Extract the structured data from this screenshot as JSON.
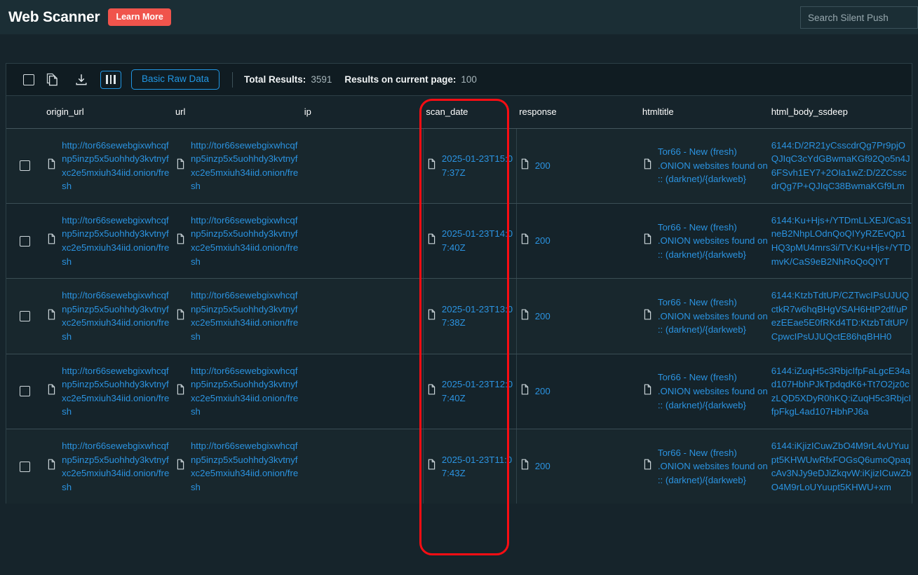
{
  "header": {
    "app_title": "Web Scanner",
    "learn_more_label": "Learn More",
    "search_placeholder": "Search Silent Push",
    "search_value": ""
  },
  "toolbar": {
    "select_all_icon": "checkbox-icon",
    "copy_icon": "copy-icon",
    "download_icon": "download-icon",
    "columns_icon": "columns-icon",
    "raw_data_label": "Basic Raw Data",
    "total_results_label": "Total Results:",
    "total_results_value": "3591",
    "page_results_label": "Results on current page:",
    "page_results_value": "100"
  },
  "table": {
    "columns": [
      "origin_url",
      "url",
      "ip",
      "scan_date",
      "response",
      "htmltitle",
      "html_body_ssdeep"
    ],
    "rows": [
      {
        "origin_url": "http://tor66sewebgixwhcqfnp5inzp5x5uohhdy3kvtnyfxc2e5mxiuh34iid.onion/fresh",
        "url": "http://tor66sewebgixwhcqfnp5inzp5x5uohhdy3kvtnyfxc2e5mxiuh34iid.onion/fresh",
        "ip": "",
        "scan_date": "2025-01-23T15:07:37Z",
        "response": "200",
        "htmltitle": "Tor66 - New (fresh) .ONION websites found on :: (darknet)/{darkweb}",
        "html_body_ssdeep": "6144:D/2R21yCsscdrQg7Pr9pjOQJIqC3cYdGBwmaKGf92Qo5n4J6FSvh1EY7+2OIa1wZ:D/2ZCsscdrQg7P+QJIqC38BwmaKGf9Lm"
      },
      {
        "origin_url": "http://tor66sewebgixwhcqfnp5inzp5x5uohhdy3kvtnyfxc2e5mxiuh34iid.onion/fresh",
        "url": "http://tor66sewebgixwhcqfnp5inzp5x5uohhdy3kvtnyfxc2e5mxiuh34iid.onion/fresh",
        "ip": "",
        "scan_date": "2025-01-23T14:07:40Z",
        "response": "200",
        "htmltitle": "Tor66 - New (fresh) .ONION websites found on :: (darknet)/{darkweb}",
        "html_body_ssdeep": "6144:Ku+Hjs+/YTDmLLXEJ/CaS1neB2NhpLOdnQoQIYyRZEvQp1HQ3pMU4mrs3i/TV:Ku+Hjs+/YTDmvK/CaS9eB2NhRoQoQIYT"
      },
      {
        "origin_url": "http://tor66sewebgixwhcqfnp5inzp5x5uohhdy3kvtnyfxc2e5mxiuh34iid.onion/fresh",
        "url": "http://tor66sewebgixwhcqfnp5inzp5x5uohhdy3kvtnyfxc2e5mxiuh34iid.onion/fresh",
        "ip": "",
        "scan_date": "2025-01-23T13:07:38Z",
        "response": "200",
        "htmltitle": "Tor66 - New (fresh) .ONION websites found on :: (darknet)/{darkweb}",
        "html_body_ssdeep": "6144:KtzbTdtUP/CZTwcIPsUJUQctkR7w6hqBHgVSAH6HtP2df/uPezEEae5E0fRKd4TD:KtzbTdtUP/CpwcIPsUJUQctE86hqBHH0"
      },
      {
        "origin_url": "http://tor66sewebgixwhcqfnp5inzp5x5uohhdy3kvtnyfxc2e5mxiuh34iid.onion/fresh",
        "url": "http://tor66sewebgixwhcqfnp5inzp5x5uohhdy3kvtnyfxc2e5mxiuh34iid.onion/fresh",
        "ip": "",
        "scan_date": "2025-01-23T12:07:40Z",
        "response": "200",
        "htmltitle": "Tor66 - New (fresh) .ONION websites found on :: (darknet)/{darkweb}",
        "html_body_ssdeep": "6144:iZuqH5c3RbjcIfpFaLgcE34ad107HbhPJkTpdqdK6+Tt7O2jz0czLQD5XDyR0hKQ:iZuqH5c3RbjcIfpFkgL4ad107HbhPJ6a"
      },
      {
        "origin_url": "http://tor66sewebgixwhcqfnp5inzp5x5uohhdy3kvtnyfxc2e5mxiuh34iid.onion/fresh",
        "url": "http://tor66sewebgixwhcqfnp5inzp5x5uohhdy3kvtnyfxc2e5mxiuh34iid.onion/fresh",
        "ip": "",
        "scan_date": "2025-01-23T11:07:43Z",
        "response": "200",
        "htmltitle": "Tor66 - New (fresh) .ONION websites found on :: (darknet)/{darkweb}",
        "html_body_ssdeep": "6144:iKjizICuwZbO4M9rL4vUYuupt5KHWUwRfxFOGsQ6umoQpaqcAv3NJy9eDJiZkqvW:iKjizICuwZbO4M9rLoUYuupt5KHWU+xm"
      }
    ]
  },
  "annotation": {
    "highlight_color": "#fb0d13",
    "highlighted_column": "scan_date"
  },
  "colors": {
    "page_bg": "#16242b",
    "topbar_bg": "#1b2e35",
    "accent_red": "#f0544c",
    "link_blue": "#2b93e0",
    "border_blue": "#2196e3"
  }
}
